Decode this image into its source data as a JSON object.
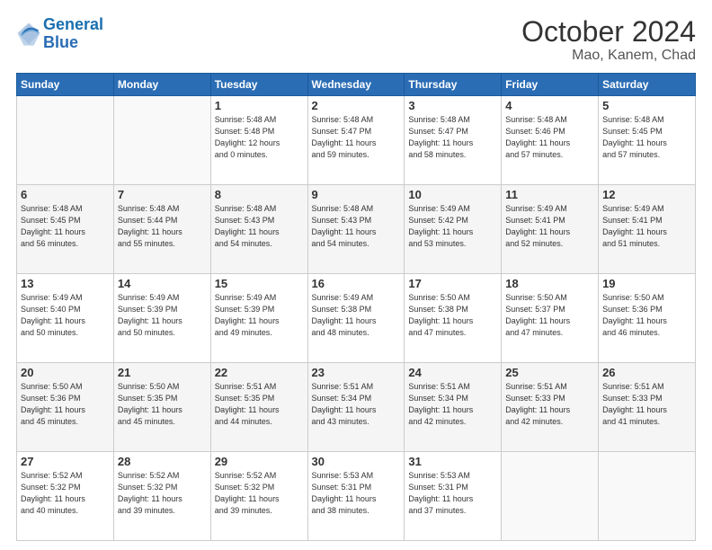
{
  "logo": {
    "line1": "General",
    "line2": "Blue"
  },
  "title": "October 2024",
  "subtitle": "Mao, Kanem, Chad",
  "days_of_week": [
    "Sunday",
    "Monday",
    "Tuesday",
    "Wednesday",
    "Thursday",
    "Friday",
    "Saturday"
  ],
  "weeks": [
    [
      {
        "day": "",
        "info": ""
      },
      {
        "day": "",
        "info": ""
      },
      {
        "day": "1",
        "info": "Sunrise: 5:48 AM\nSunset: 5:48 PM\nDaylight: 12 hours\nand 0 minutes."
      },
      {
        "day": "2",
        "info": "Sunrise: 5:48 AM\nSunset: 5:47 PM\nDaylight: 11 hours\nand 59 minutes."
      },
      {
        "day": "3",
        "info": "Sunrise: 5:48 AM\nSunset: 5:47 PM\nDaylight: 11 hours\nand 58 minutes."
      },
      {
        "day": "4",
        "info": "Sunrise: 5:48 AM\nSunset: 5:46 PM\nDaylight: 11 hours\nand 57 minutes."
      },
      {
        "day": "5",
        "info": "Sunrise: 5:48 AM\nSunset: 5:45 PM\nDaylight: 11 hours\nand 57 minutes."
      }
    ],
    [
      {
        "day": "6",
        "info": "Sunrise: 5:48 AM\nSunset: 5:45 PM\nDaylight: 11 hours\nand 56 minutes."
      },
      {
        "day": "7",
        "info": "Sunrise: 5:48 AM\nSunset: 5:44 PM\nDaylight: 11 hours\nand 55 minutes."
      },
      {
        "day": "8",
        "info": "Sunrise: 5:48 AM\nSunset: 5:43 PM\nDaylight: 11 hours\nand 54 minutes."
      },
      {
        "day": "9",
        "info": "Sunrise: 5:48 AM\nSunset: 5:43 PM\nDaylight: 11 hours\nand 54 minutes."
      },
      {
        "day": "10",
        "info": "Sunrise: 5:49 AM\nSunset: 5:42 PM\nDaylight: 11 hours\nand 53 minutes."
      },
      {
        "day": "11",
        "info": "Sunrise: 5:49 AM\nSunset: 5:41 PM\nDaylight: 11 hours\nand 52 minutes."
      },
      {
        "day": "12",
        "info": "Sunrise: 5:49 AM\nSunset: 5:41 PM\nDaylight: 11 hours\nand 51 minutes."
      }
    ],
    [
      {
        "day": "13",
        "info": "Sunrise: 5:49 AM\nSunset: 5:40 PM\nDaylight: 11 hours\nand 50 minutes."
      },
      {
        "day": "14",
        "info": "Sunrise: 5:49 AM\nSunset: 5:39 PM\nDaylight: 11 hours\nand 50 minutes."
      },
      {
        "day": "15",
        "info": "Sunrise: 5:49 AM\nSunset: 5:39 PM\nDaylight: 11 hours\nand 49 minutes."
      },
      {
        "day": "16",
        "info": "Sunrise: 5:49 AM\nSunset: 5:38 PM\nDaylight: 11 hours\nand 48 minutes."
      },
      {
        "day": "17",
        "info": "Sunrise: 5:50 AM\nSunset: 5:38 PM\nDaylight: 11 hours\nand 47 minutes."
      },
      {
        "day": "18",
        "info": "Sunrise: 5:50 AM\nSunset: 5:37 PM\nDaylight: 11 hours\nand 47 minutes."
      },
      {
        "day": "19",
        "info": "Sunrise: 5:50 AM\nSunset: 5:36 PM\nDaylight: 11 hours\nand 46 minutes."
      }
    ],
    [
      {
        "day": "20",
        "info": "Sunrise: 5:50 AM\nSunset: 5:36 PM\nDaylight: 11 hours\nand 45 minutes."
      },
      {
        "day": "21",
        "info": "Sunrise: 5:50 AM\nSunset: 5:35 PM\nDaylight: 11 hours\nand 45 minutes."
      },
      {
        "day": "22",
        "info": "Sunrise: 5:51 AM\nSunset: 5:35 PM\nDaylight: 11 hours\nand 44 minutes."
      },
      {
        "day": "23",
        "info": "Sunrise: 5:51 AM\nSunset: 5:34 PM\nDaylight: 11 hours\nand 43 minutes."
      },
      {
        "day": "24",
        "info": "Sunrise: 5:51 AM\nSunset: 5:34 PM\nDaylight: 11 hours\nand 42 minutes."
      },
      {
        "day": "25",
        "info": "Sunrise: 5:51 AM\nSunset: 5:33 PM\nDaylight: 11 hours\nand 42 minutes."
      },
      {
        "day": "26",
        "info": "Sunrise: 5:51 AM\nSunset: 5:33 PM\nDaylight: 11 hours\nand 41 minutes."
      }
    ],
    [
      {
        "day": "27",
        "info": "Sunrise: 5:52 AM\nSunset: 5:32 PM\nDaylight: 11 hours\nand 40 minutes."
      },
      {
        "day": "28",
        "info": "Sunrise: 5:52 AM\nSunset: 5:32 PM\nDaylight: 11 hours\nand 39 minutes."
      },
      {
        "day": "29",
        "info": "Sunrise: 5:52 AM\nSunset: 5:32 PM\nDaylight: 11 hours\nand 39 minutes."
      },
      {
        "day": "30",
        "info": "Sunrise: 5:53 AM\nSunset: 5:31 PM\nDaylight: 11 hours\nand 38 minutes."
      },
      {
        "day": "31",
        "info": "Sunrise: 5:53 AM\nSunset: 5:31 PM\nDaylight: 11 hours\nand 37 minutes."
      },
      {
        "day": "",
        "info": ""
      },
      {
        "day": "",
        "info": ""
      }
    ]
  ]
}
